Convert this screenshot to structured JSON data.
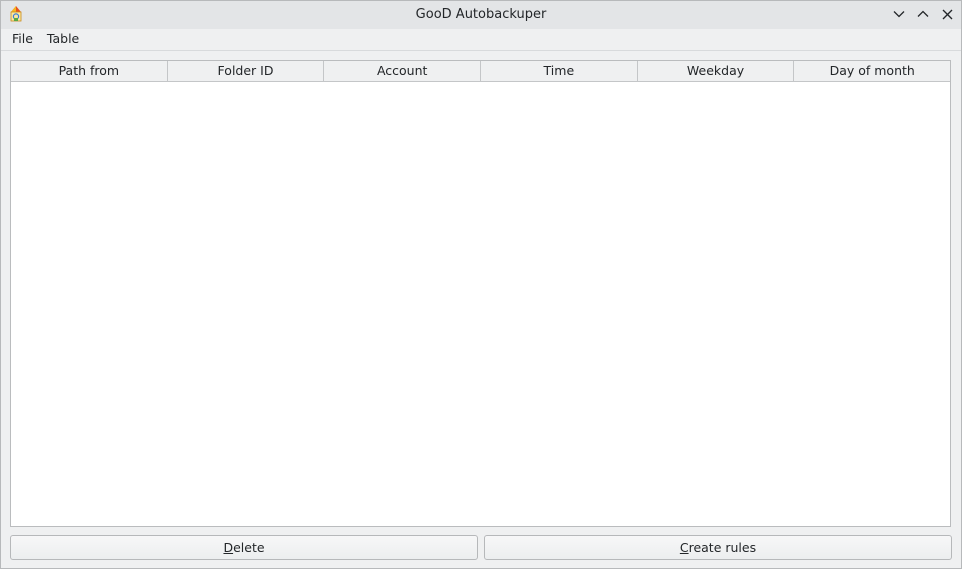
{
  "window": {
    "title": "GooD Autobackuper",
    "icon": "app-logo-icon",
    "controls": {
      "minimize_icon": "chevron-down-icon",
      "maximize_icon": "chevron-up-icon",
      "close_icon": "close-icon"
    }
  },
  "menubar": {
    "items": [
      {
        "label": "File"
      },
      {
        "label": "Table"
      }
    ]
  },
  "table": {
    "columns": [
      "Path from",
      "Folder ID",
      "Account",
      "Time",
      "Weekday",
      "Day of month"
    ],
    "rows": []
  },
  "buttons": {
    "delete": {
      "mnemonic": "D",
      "rest": "elete"
    },
    "create_rules": {
      "mnemonic": "C",
      "rest": "reate rules"
    }
  },
  "colors": {
    "background": "#eff0f1",
    "table_background": "#ffffff",
    "border": "#babcbe"
  }
}
